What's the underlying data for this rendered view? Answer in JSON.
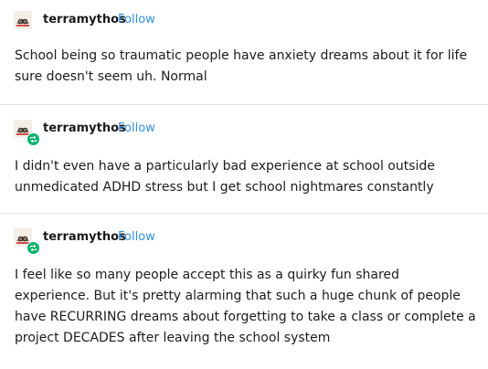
{
  "posts": [
    {
      "username": "terramythos",
      "follow_label": "Follow",
      "has_reblog_badge": false,
      "text": "School being so traumatic people have anxiety dreams about it for life sure doesn't seem uh. Normal"
    },
    {
      "username": "terramythos",
      "follow_label": "Follow",
      "has_reblog_badge": true,
      "text": "I didn't even have a particularly bad experience at school outside unmedicated ADHD stress but I get school nightmares constantly"
    },
    {
      "username": "terramythos",
      "follow_label": "Follow",
      "has_reblog_badge": true,
      "text": "I feel like so many people accept this as a quirky fun shared experience. But it's pretty alarming that such a huge chunk of people have RECURRING dreams about forgetting to take a class or complete a project DECADES after leaving the school system"
    }
  ],
  "colors": {
    "follow": "#2e8ee0",
    "reblog_badge": "#00b36b",
    "divider": "#e1e1e1"
  },
  "icons": {
    "avatar": "sloth-with-glasses-avatar-icon",
    "reblog_badge": "reblog-arrows-icon"
  }
}
